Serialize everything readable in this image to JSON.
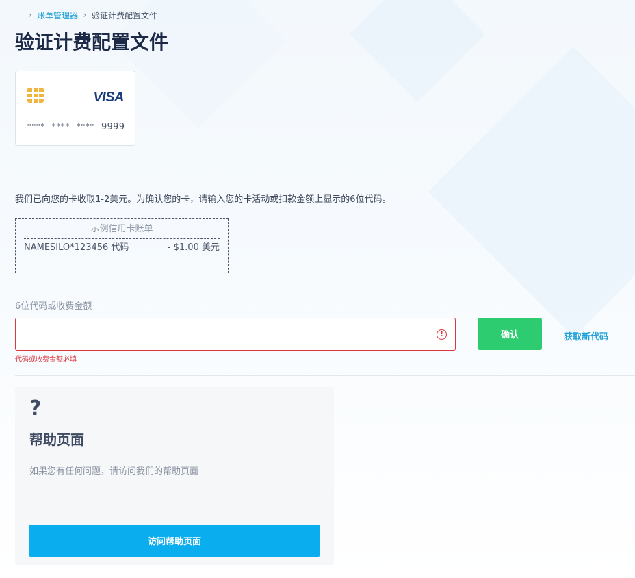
{
  "breadcrumb": {
    "items": [
      "账单管理器",
      "验证计费配置文件"
    ]
  },
  "page_title": "验证计费配置文件",
  "card": {
    "brand": "VISA",
    "masked_groups": [
      "****",
      "****",
      "****"
    ],
    "last4": "9999"
  },
  "instruction": "我们已向您的卡收取1-2美元。为确认您的卡，请输入您的卡活动或扣款金额上显示的6位代码。",
  "example": {
    "title": "示例信用卡账单",
    "merchant": "NAMESILO*123456 代码",
    "amount": "- $1.00 美元"
  },
  "code_field": {
    "label": "6位代码或收费金额",
    "value": "",
    "placeholder": "",
    "error": "代码或收费金额必填"
  },
  "actions": {
    "confirm_label": "确认",
    "new_code_label": "获取新代码"
  },
  "help": {
    "icon": "?",
    "title": "帮助页面",
    "description": "如果您有任何问题，请访问我们的帮助页面",
    "button_label": "访问帮助页面"
  },
  "colors": {
    "accent_blue": "#0aadee",
    "link_blue": "#1ea0d8",
    "confirm_green": "#2ecc71",
    "error_red": "#d9363e",
    "title_navy": "#1c2a48"
  }
}
